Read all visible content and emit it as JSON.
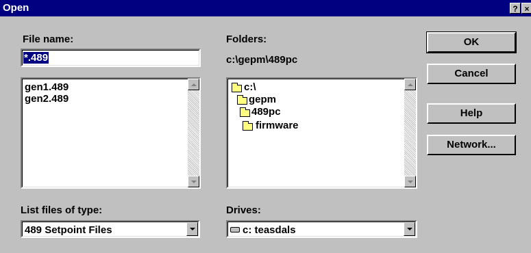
{
  "window": {
    "title": "Open",
    "help_glyph": "?",
    "close_glyph": "×"
  },
  "file_name": {
    "label": "File name:",
    "value": "*.489"
  },
  "files": [
    "gen1.489",
    "gen2.489"
  ],
  "folders": {
    "label": "Folders:",
    "current_path": "c:\\gepm\\489pc",
    "tree": [
      "c:\\",
      "gepm",
      "489pc",
      "firmware"
    ]
  },
  "file_type": {
    "label": "List files of type:",
    "selected": "489 Setpoint Files"
  },
  "drives": {
    "label": "Drives:",
    "selected": "c: teasdals"
  },
  "buttons": {
    "ok": "OK",
    "cancel": "Cancel",
    "help": "Help",
    "network": "Network..."
  },
  "colors": {
    "title_bar": "#000080",
    "face": "#c0c0c0",
    "selection": "#000080",
    "folder": "#ffff80"
  }
}
